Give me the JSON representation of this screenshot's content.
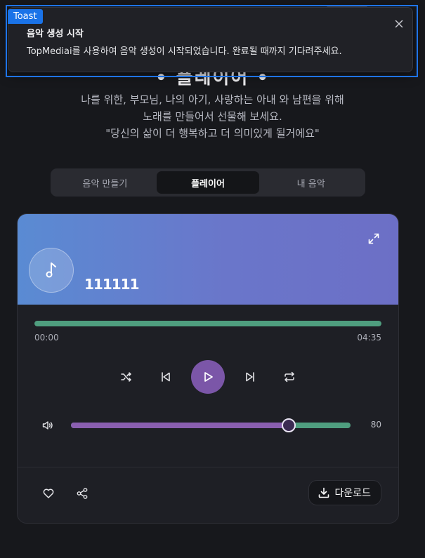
{
  "hero": {
    "title": "• 플레이어 •",
    "lines": [
      "나를 위한, 부모님, 나의 아기, 사랑하는 아내 와 남편을 위해",
      "노래를 만들어서 선물해 보세요.",
      "\"당신의 삶이 더 행복하고 더 의미있게 될거에요\""
    ]
  },
  "tabs": [
    {
      "label": "음악 만들기",
      "active": false
    },
    {
      "label": "플레이어",
      "active": true
    },
    {
      "label": "내 음악",
      "active": false
    }
  ],
  "player": {
    "song_title": "111111",
    "cover_icon": "music-note-icon",
    "current_time": "00:00",
    "duration": "04:35",
    "progress_fraction": 1.0,
    "volume": 80,
    "volume_fill_fraction": 0.78,
    "volume_label": "80",
    "download_label": "다운로드",
    "controls": [
      "shuffle-icon",
      "previous-icon",
      "play-icon",
      "next-icon",
      "repeat-icon"
    ]
  },
  "toast": {
    "tag": "Toast",
    "title": "음악 생성 시작",
    "message": "TopMediai를 사용하여 음악 생성이 시작되었습니다. 완료될 때까지 기다려주세요."
  },
  "colors": {
    "background": "#17181c",
    "accent_purple": "#7b56a8",
    "progress_green": "#4f9e7f",
    "header_gradient_start": "#5a8bd3",
    "header_gradient_end": "#6c6fc6",
    "toast_outline": "#1f74e8"
  }
}
